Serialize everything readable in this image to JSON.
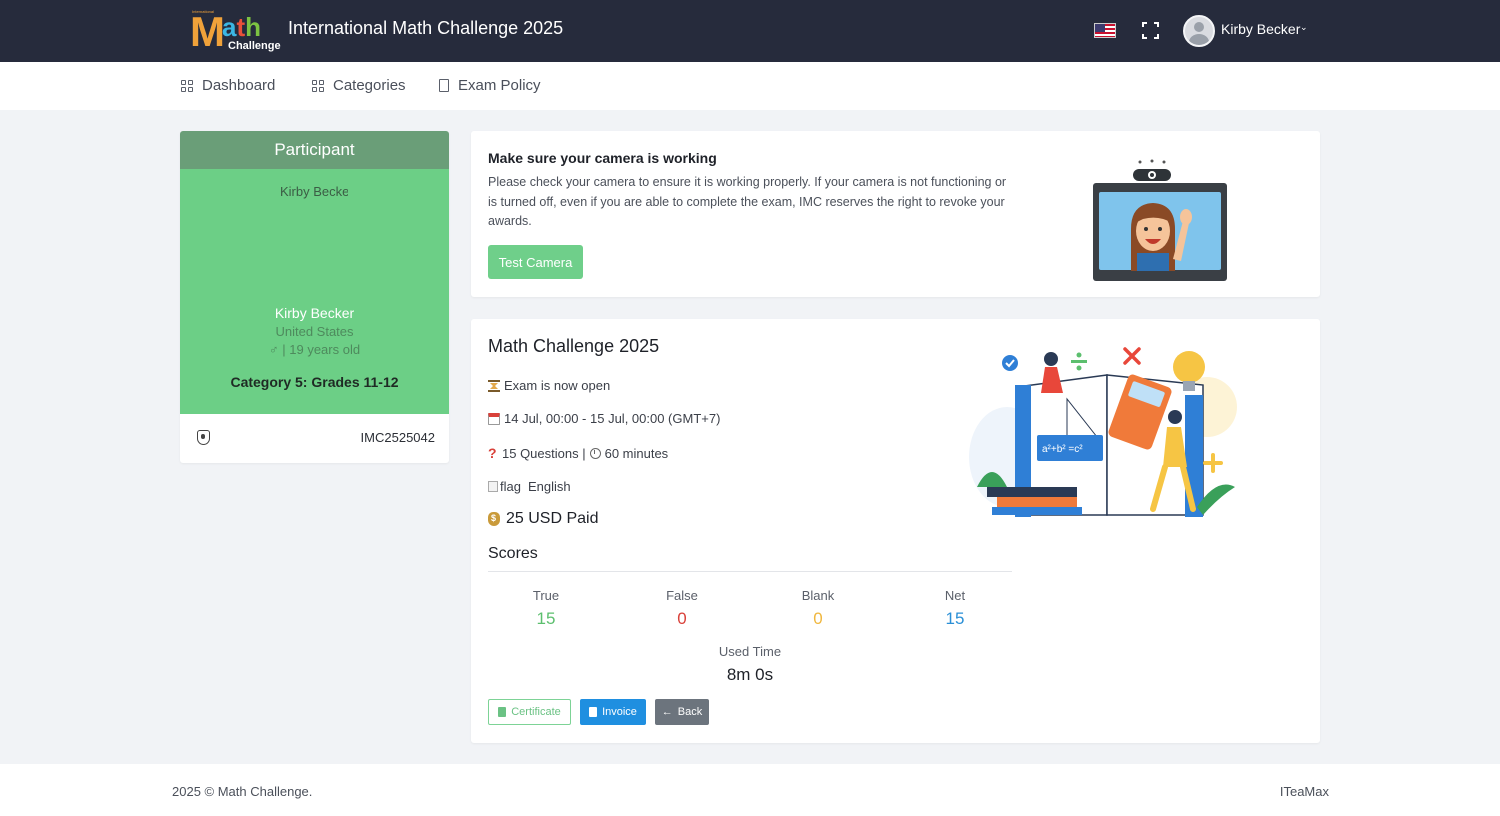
{
  "header": {
    "logo_letter": "M",
    "logo_ath": [
      "a",
      "t",
      "h"
    ],
    "logo_challenge": "Challenge",
    "logo_international": "International",
    "title": "International Math Challenge 2025",
    "user_name": "Kirby Becker"
  },
  "nav": {
    "items": [
      {
        "label": "Dashboard",
        "icon": "grid-icon"
      },
      {
        "label": "Categories",
        "icon": "grid-icon"
      },
      {
        "label": "Exam Policy",
        "icon": "document-icon"
      }
    ]
  },
  "participant": {
    "heading": "Participant",
    "photo_alt": "Kirby Becker",
    "name": "Kirby Becker",
    "country": "United States",
    "age_line": "♂ | 19 years old",
    "category": "Category 5: Grades 11-12",
    "id": "IMC2525042"
  },
  "camera": {
    "title": "Make sure your camera is working",
    "text": "Please check your camera to ensure it is working properly. If your camera is not functioning or is turned off, even if you are able to complete the exam, IMC reserves the right to revoke your awards.",
    "button": "Test Camera"
  },
  "exam": {
    "title": "Math Challenge 2025",
    "status": "Exam is now open",
    "dates": "14 Jul, 00:00 - 15 Jul, 00:00 (GMT+7)",
    "questions": "15 Questions |",
    "minutes": "60 minutes",
    "flag_alt": "flag",
    "language": "English",
    "paid": "25 USD Paid",
    "scores_heading": "Scores",
    "scores": [
      {
        "label": "True",
        "value": "15",
        "color": "#5cbf6e"
      },
      {
        "label": "False",
        "value": "0",
        "color": "#d9413a"
      },
      {
        "label": "Blank",
        "value": "0",
        "color": "#f0b73e"
      },
      {
        "label": "Net",
        "value": "15",
        "color": "#2a8fd6"
      }
    ],
    "used_time_label": "Used Time",
    "used_time": "8m 0s",
    "buttons": {
      "certificate": "Certificate",
      "invoice": "Invoice",
      "back": "Back"
    },
    "formula": "a²+b² =c²"
  },
  "footer": {
    "copyright": "2025 © Math Challenge.",
    "brand": "ITeaMax"
  },
  "colors": {
    "topbar": "#262b3c",
    "participant_header": "#6a9e78",
    "participant_body": "#6ccf86",
    "accent_green": "#6fcf8a",
    "invoice_blue": "#1f8fe0"
  }
}
